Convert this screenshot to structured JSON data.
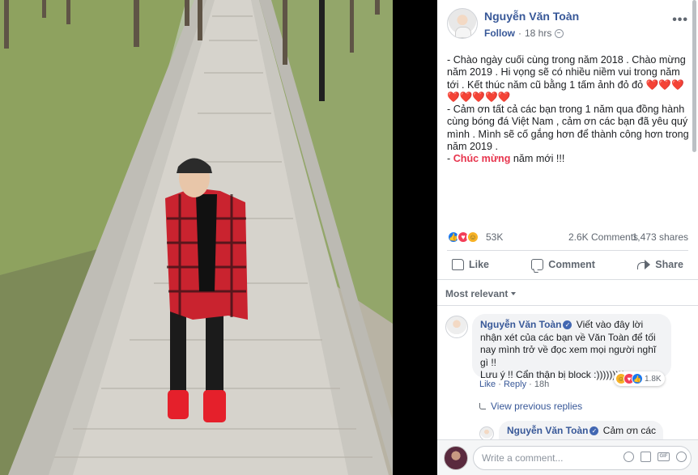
{
  "post": {
    "author": "Nguyễn Văn Toàn",
    "follow_label": "Follow",
    "separator": "·",
    "time": "18 hrs",
    "more_label": "•••",
    "text_lines": [
      "- Chào ngày cuối cùng trong năm 2018 . Chào mừng năm 2019 . Hi vọng sẽ có nhiều niềm vui trong năm tới . Kết thúc năm cũ bằng 1 tấm ảnh đỏ đỏ ❤️❤️❤️❤️❤️❤️❤️❤️",
      "- Cảm ơn tất cả các bạn trong 1 năm qua đồng hành cùng bóng đá Việt Nam , cảm ơn các bạn đã yêu quý mình . Mình sẽ cố gắng hơn để thành công hơn trong năm 2019 ."
    ],
    "line1_text": "- Chào ngày cuối cùng trong năm 2018 . Chào mừng năm 2019 . Hi vọng sẽ có nhiều niềm vui trong năm tới . Kết thúc năm cũ bằng 1 tấm ảnh đỏ đỏ",
    "line1_hearts": "❤️❤️❤️❤️❤️❤️❤️❤️",
    "line2_text": "- Cảm ơn tất cả các bạn trong 1 năm qua đồng hành cùng bóng đá Việt Nam , cảm ơn các bạn đã yêu quý mình . Mình sẽ cố gắng hơn để thành công hơn trong năm 2019 .",
    "line3_prefix": "- ",
    "line3_highlight": "Chúc mừng",
    "line3_suffix": " năm mới !!!"
  },
  "stats": {
    "reaction_count": "53K",
    "comments": "2.6K Comments",
    "shares": "1,473 shares"
  },
  "actions": {
    "like": "Like",
    "comment": "Comment",
    "share": "Share"
  },
  "sort_label": "Most relevant",
  "comment": {
    "author": "Nguyễn Văn Toàn",
    "text": "Viết vào đây lời nhận xét của các bạn về Văn Toàn để tối nay mình trở về đọc xem mọi người nghĩ gì !!",
    "text2": "Lưu ý !! Cẩn thận bị block :)))))))))",
    "reaction_count": "1.8K",
    "like_label": "Like",
    "reply_label": "Reply",
    "time": "18h",
    "link_separator": "·"
  },
  "view_previous": "View previous replies",
  "reply": {
    "author": "Nguyễn Văn Toàn",
    "text": "Cảm ơn các"
  },
  "composer": {
    "placeholder": "Write a comment..."
  },
  "colors": {
    "link_blue": "#385898",
    "accent_red": "#e7344d",
    "like_blue": "#1877f2",
    "love_red": "#f33e58",
    "haha_yellow": "#f7b125"
  },
  "icons": [
    "globe-icon",
    "more-icon",
    "like-icon",
    "comment-icon",
    "share-icon",
    "verified-icon",
    "reply-arrow-icon",
    "emoji-icon",
    "camera-icon",
    "gif-icon",
    "sticker-icon"
  ]
}
